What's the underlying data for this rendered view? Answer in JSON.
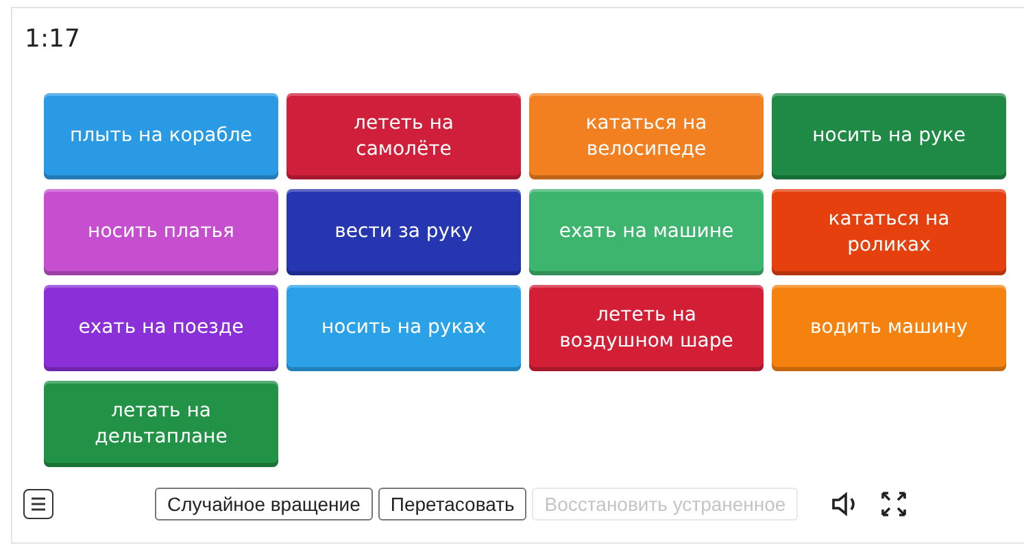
{
  "timer": "1:17",
  "tiles": [
    {
      "text": "плыть на корабле",
      "color": "#2b9ae4"
    },
    {
      "text": "лететь на самолёте",
      "color": "#d01f3a"
    },
    {
      "text": "кататься на велосипеде",
      "color": "#f28020"
    },
    {
      "text": "носить на руке",
      "color": "#1e8a45"
    },
    {
      "text": "носить платья",
      "color": "#c64fcf"
    },
    {
      "text": "вести за руку",
      "color": "#2636b0"
    },
    {
      "text": "ехать на машине",
      "color": "#3db56e"
    },
    {
      "text": "кататься на роликах",
      "color": "#e5400e"
    },
    {
      "text": "ехать на поезде",
      "color": "#8b2fd8"
    },
    {
      "text": "носить на руках",
      "color": "#2ba2e8"
    },
    {
      "text": "лететь на воздушном шаре",
      "color": "#d21f36"
    },
    {
      "text": "водить машину",
      "color": "#f5820e"
    },
    {
      "text": "летать на дельтаплане",
      "color": "#219246"
    }
  ],
  "toolbar": {
    "buttons": [
      {
        "label": "Случайное вращение",
        "disabled": false
      },
      {
        "label": "Перетасовать",
        "disabled": false
      },
      {
        "label": "Восстановить устраненное",
        "disabled": true
      }
    ]
  }
}
